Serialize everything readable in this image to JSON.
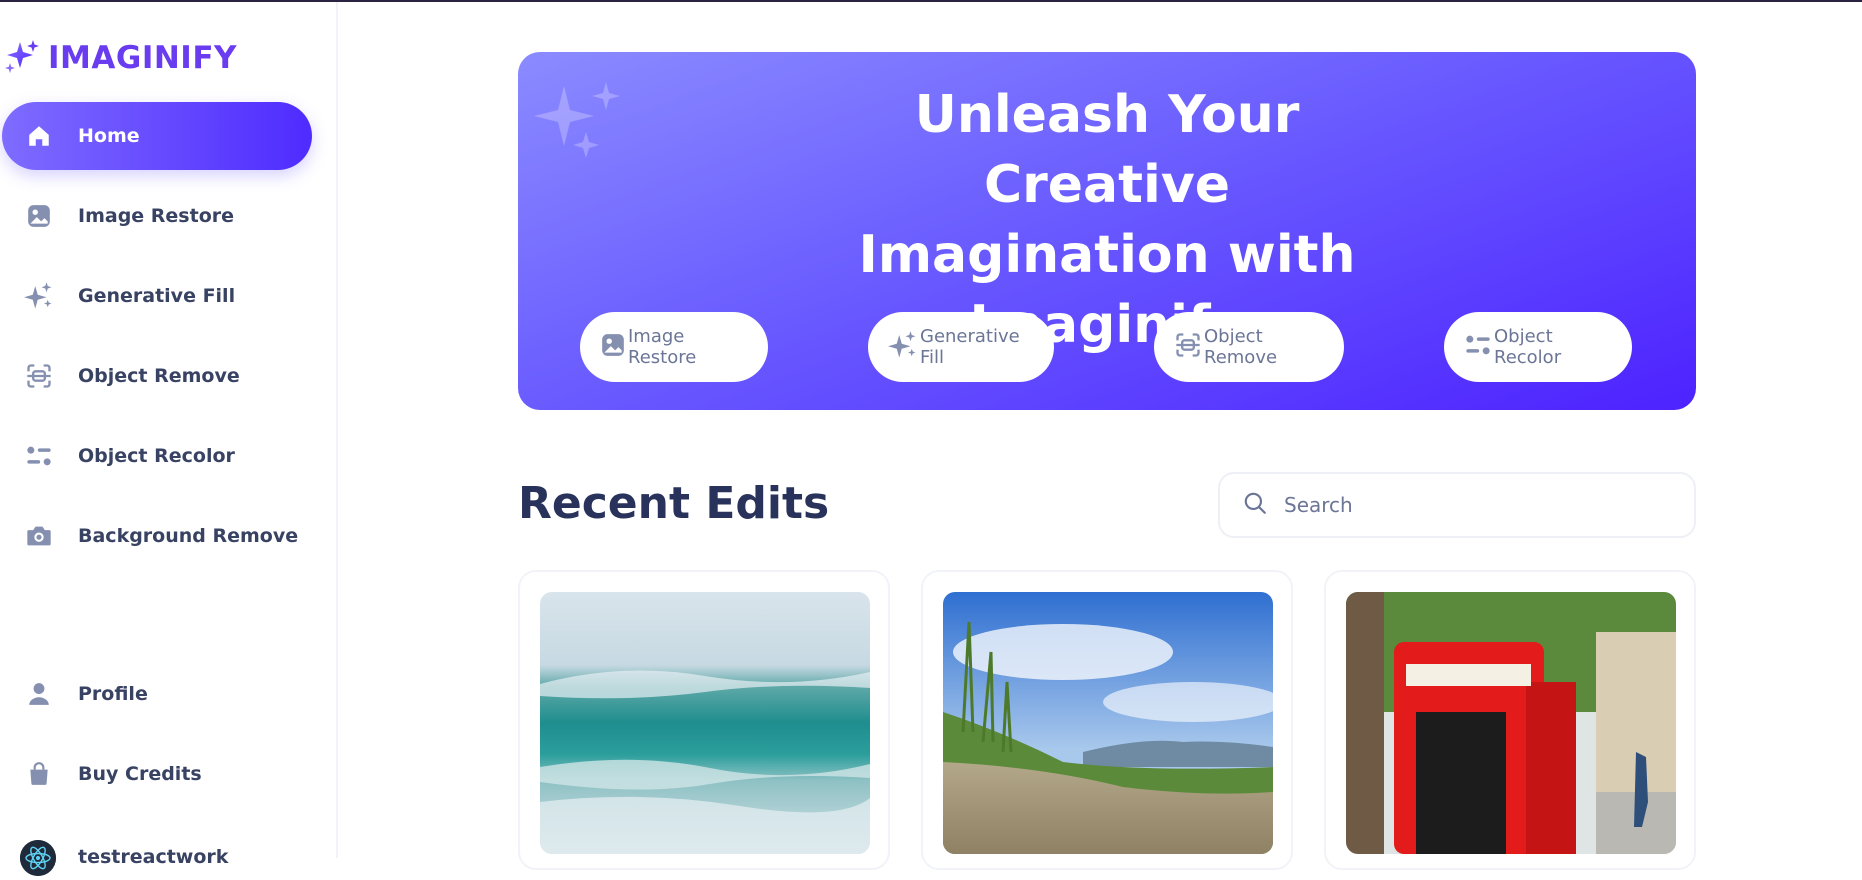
{
  "app": {
    "logo_text": "IMAGINIFY"
  },
  "sidebar": {
    "items": [
      {
        "label": "Home",
        "icon": "home-icon",
        "active": true
      },
      {
        "label": "Image Restore",
        "icon": "image-icon"
      },
      {
        "label": "Generative Fill",
        "icon": "sparkles-icon"
      },
      {
        "label": "Object Remove",
        "icon": "scan-icon"
      },
      {
        "label": "Object Recolor",
        "icon": "filter-icon"
      },
      {
        "label": "Background Remove",
        "icon": "camera-icon"
      }
    ],
    "bottom_items": [
      {
        "label": "Profile",
        "icon": "profile-icon"
      },
      {
        "label": "Buy Credits",
        "icon": "bag-icon"
      }
    ],
    "user": {
      "name": "testreactwork"
    }
  },
  "banner": {
    "title_lines": [
      "Unleash Your Creative",
      "Imagination with",
      "Imaginify"
    ],
    "quick_links": [
      {
        "label": "Image Restore",
        "icon": "image-icon"
      },
      {
        "label": "Generative Fill",
        "icon": "sparkles-icon"
      },
      {
        "label": "Object Remove",
        "icon": "scan-icon"
      },
      {
        "label": "Object Recolor",
        "icon": "filter-icon"
      }
    ]
  },
  "recent": {
    "title": "Recent Edits",
    "search_placeholder": "Search",
    "images": [
      {
        "subject": "ocean-wave"
      },
      {
        "subject": "grass-sky-landscape"
      },
      {
        "subject": "red-telephone-booth"
      }
    ]
  },
  "colors": {
    "brand": "#6a3cf0",
    "accent_start": "#7e6cff",
    "accent_end": "#4f2bff",
    "text_dark": "#28325a",
    "text_muted": "#6b7596"
  }
}
